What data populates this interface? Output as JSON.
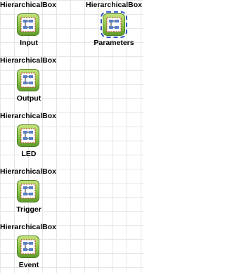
{
  "blocks": [
    {
      "type_label": "HierarchicalBox",
      "name": "Input",
      "icon": "hierarchical-box-icon"
    },
    {
      "type_label": "HierarchicalBox",
      "name": "Parameters",
      "icon": "hierarchical-box-icon",
      "selected": true
    },
    {
      "type_label": "HierarchicalBox",
      "name": "Output",
      "icon": "hierarchical-box-icon"
    },
    {
      "type_label": "HierarchicalBox",
      "name": "LED",
      "icon": "hierarchical-box-icon"
    },
    {
      "type_label": "HierarchicalBox",
      "name": "Trigger",
      "icon": "hierarchical-box-icon"
    },
    {
      "type_label": "HierarchicalBox",
      "name": "Event",
      "icon": "hierarchical-box-icon"
    }
  ],
  "colors": {
    "icon_green_top": "#b8d96b",
    "icon_green_bottom": "#5e9a2a",
    "icon_border": "#4c7f23",
    "selection_dash": "#2f55c2"
  }
}
